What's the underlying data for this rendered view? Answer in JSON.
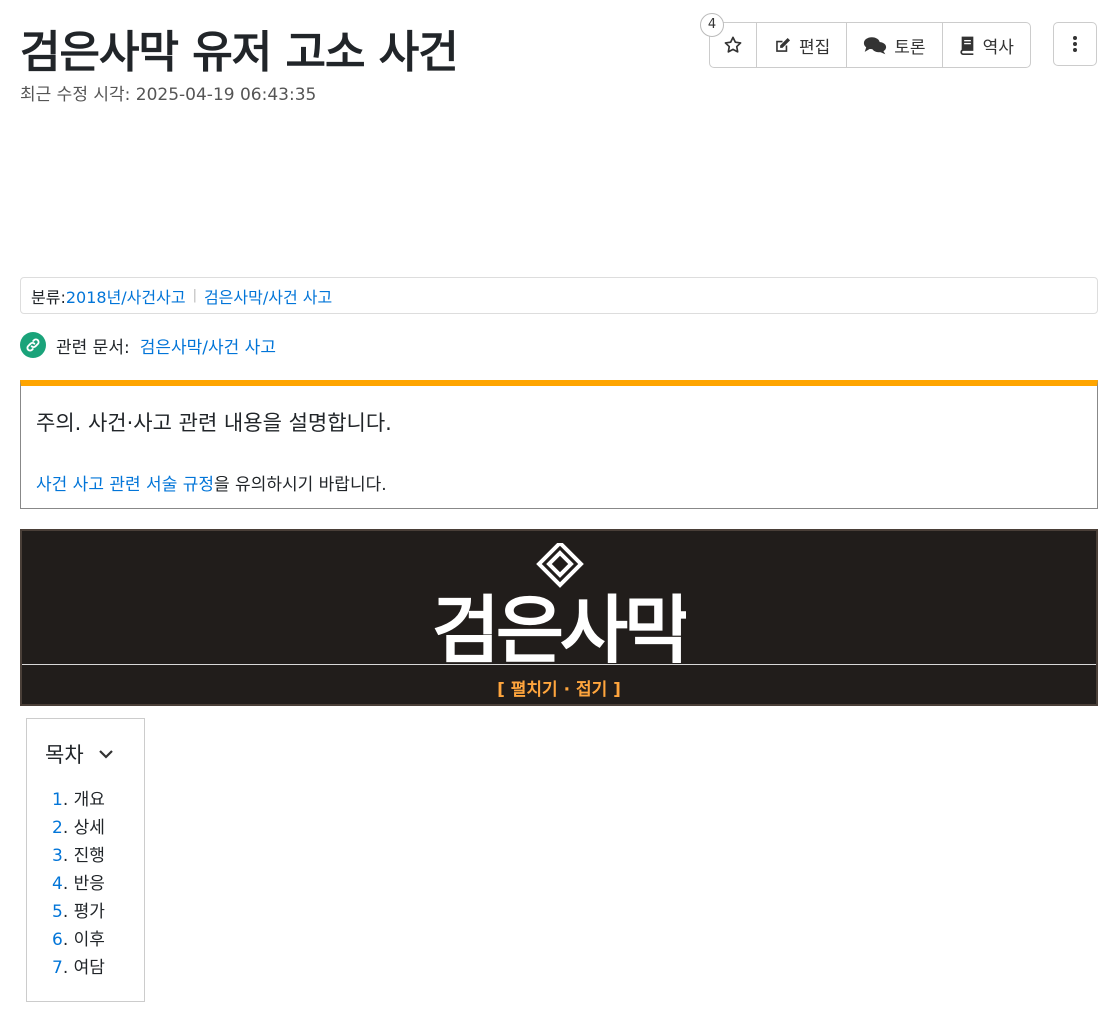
{
  "page": {
    "title": "검은사막 유저 고소 사건",
    "last_modified": "최근 수정 시각: 2025-04-19 06:43:35"
  },
  "toolbar": {
    "star_count": "4",
    "edit_label": "편집",
    "discuss_label": "토론",
    "history_label": "역사"
  },
  "category": {
    "label": "분류:",
    "items": [
      "2018년/사건사고",
      "검은사막/사건 사고"
    ]
  },
  "related": {
    "label": "관련 문서:",
    "link": "검은사막/사건 사고"
  },
  "notice": {
    "title": "주의. 사건·사고 관련 내용을 설명합니다.",
    "link": "사건 사고 관련 서술 규정",
    "suffix": "을 유의하시기 바랍니다."
  },
  "banner": {
    "logo_text": "검은사막",
    "toggle": "[ 펼치기 · 접기 ]",
    "background": "#211d1b",
    "toggle_color": "#ffa53d"
  },
  "toc": {
    "title": "목차",
    "items": [
      {
        "num": "1",
        "label": "개요"
      },
      {
        "num": "2",
        "label": "상세"
      },
      {
        "num": "3",
        "label": "진행"
      },
      {
        "num": "4",
        "label": "반응"
      },
      {
        "num": "5",
        "label": "평가"
      },
      {
        "num": "6",
        "label": "이후"
      },
      {
        "num": "7",
        "label": "여담"
      }
    ]
  },
  "colors": {
    "link": "#0275d8",
    "notice_accent": "#ffa500",
    "related_icon": "#1aa37a"
  },
  "icons": [
    "star-icon",
    "pencil-icon",
    "comments-icon",
    "book-icon",
    "more-vertical-icon",
    "link-icon",
    "chevron-down-icon"
  ]
}
